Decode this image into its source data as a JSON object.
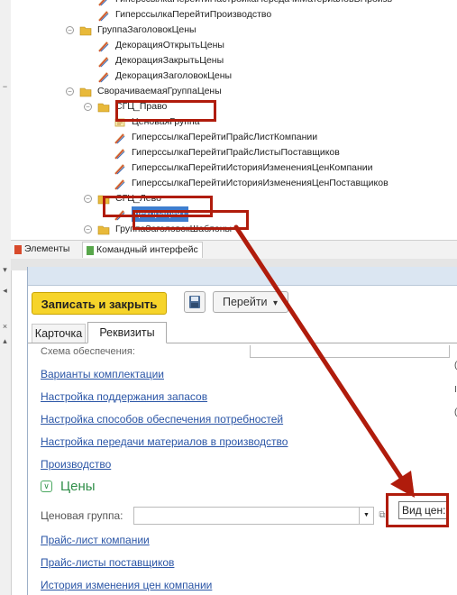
{
  "tree": [
    {
      "indent": 1,
      "expander": "",
      "icon": "hyperlink-icon",
      "label": "ГиперссылкаПерейтиНастройкаПередачиМатериаловВПроизв",
      "selected": false
    },
    {
      "indent": 1,
      "expander": "",
      "icon": "hyperlink-icon",
      "label": "ГиперссылкаПерейтиПроизводство",
      "selected": false
    },
    {
      "indent": 0,
      "expander": "⊖",
      "icon": "folder-icon",
      "label": "ГруппаЗаголовокЦены",
      "selected": false
    },
    {
      "indent": 1,
      "expander": "",
      "icon": "hyperlink-icon",
      "label": "ДекорацияОткрытьЦены",
      "selected": false
    },
    {
      "indent": 1,
      "expander": "",
      "icon": "hyperlink-icon",
      "label": "ДекорацияЗакрытьЦены",
      "selected": false
    },
    {
      "indent": 1,
      "expander": "",
      "icon": "hyperlink-icon",
      "label": "ДекорацияЗаголовокЦены",
      "selected": false
    },
    {
      "indent": 0,
      "expander": "⊖",
      "icon": "folder-icon",
      "label": "СворачиваемаяГруппаЦены",
      "selected": false
    },
    {
      "indent": 1,
      "expander": "⊖",
      "icon": "folder-icon",
      "label": "СГЦ_Право",
      "selected": false
    },
    {
      "indent": 2,
      "expander": "",
      "icon": "field-icon",
      "label": "ЦеноваяГруппа",
      "selected": false
    },
    {
      "indent": 2,
      "expander": "",
      "icon": "hyperlink-icon",
      "label": "ГиперссылкаПерейтиПрайсЛистКомпании",
      "selected": false
    },
    {
      "indent": 2,
      "expander": "",
      "icon": "hyperlink-icon",
      "label": "ГиперссылкаПерейтиПрайсЛистыПоставщиков",
      "selected": false
    },
    {
      "indent": 2,
      "expander": "",
      "icon": "hyperlink-icon",
      "label": "ГиперссылкаПерейтиИсторияИзмененияЦенКомпании",
      "selected": false
    },
    {
      "indent": 2,
      "expander": "",
      "icon": "hyperlink-icon",
      "label": "ГиперссылкаПерейтиИсторияИзмененияЦенПоставщиков",
      "selected": false
    },
    {
      "indent": 1,
      "expander": "⊖",
      "icon": "folder-icon",
      "label": "СГЦ_Лево",
      "selected": false
    },
    {
      "indent": 2,
      "expander": "",
      "icon": "hyperlink-icon",
      "label": "Декорация1",
      "selected": true
    },
    {
      "indent": 1,
      "expander": "⊖",
      "icon": "folder-icon",
      "label": "ГруппаЗаголовокШаблоны",
      "selected": false
    }
  ],
  "bottom_tabs": {
    "elements": "Элементы",
    "command_interface": "Командный интерфейс"
  },
  "form": {
    "save_close": "Записать и закрыть",
    "goto": "Перейти",
    "goto_arrow": "▾",
    "tabs": {
      "card": "Карточка",
      "requisites": "Реквизиты"
    },
    "scheme_label": "Схема обеспечения:",
    "links": [
      "Варианты комплектации",
      "Настройка поддержания запасов",
      "Настройка способов обеспечения потребностей",
      "Настройка передачи материалов в производство",
      "Производство"
    ],
    "prices_title": "Цены",
    "price_group_label": "Ценовая группа:",
    "price_links": [
      "Прайс-лист компании",
      "Прайс-листы поставщиков",
      "История изменения цен компании"
    ],
    "vid_tsen": "Вид цен:"
  },
  "colors": {
    "highlight": "#b01c0c",
    "accent": "#f6d42a",
    "link": "#2a55a6",
    "group": "#2f8e48",
    "selection": "#3e7ecf"
  }
}
